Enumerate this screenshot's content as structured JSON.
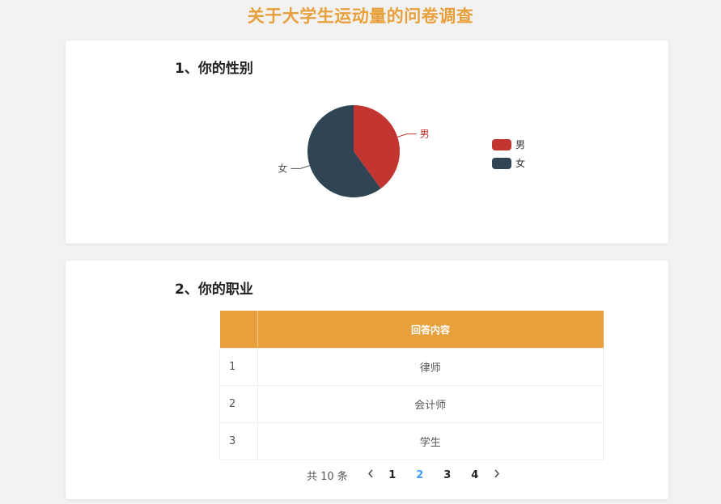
{
  "page": {
    "title": "关于大学生运动量的问卷调查"
  },
  "q1": {
    "title": "1、你的性别",
    "legend": [
      {
        "label": "男",
        "color": "#c23531"
      },
      {
        "label": "女",
        "color": "#2f4554"
      }
    ]
  },
  "chart_data": {
    "type": "pie",
    "categories": [
      "男",
      "女"
    ],
    "values": [
      40,
      60
    ],
    "colors": [
      "#c23531",
      "#2f4554"
    ],
    "title": "",
    "legend_position": "right"
  },
  "q2": {
    "title": "2、你的职业",
    "table": {
      "headers": [
        "",
        "回答内容"
      ],
      "rows": [
        [
          "1",
          "律师"
        ],
        [
          "2",
          "会计师"
        ],
        [
          "3",
          "学生"
        ]
      ]
    },
    "pagination": {
      "total_text": "共 10 条",
      "prev_icon": "chevron-left-icon",
      "next_icon": "chevron-right-icon",
      "pages": [
        "1",
        "2",
        "3",
        "4"
      ],
      "current": "2"
    }
  }
}
